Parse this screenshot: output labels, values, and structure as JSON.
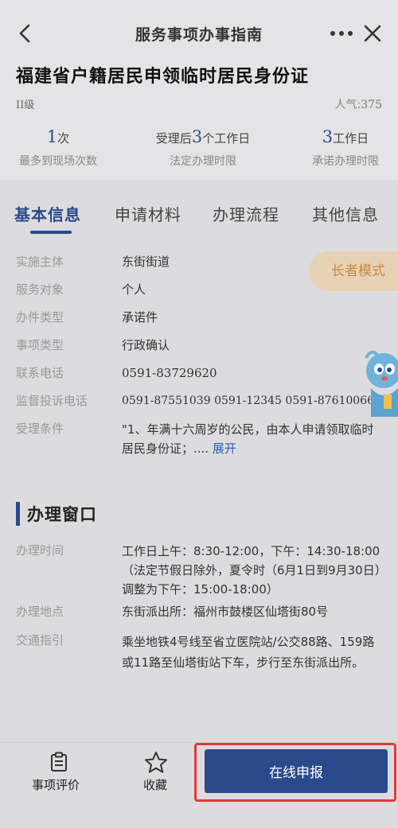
{
  "nav": {
    "title": "服务事项办事指南"
  },
  "item": {
    "title": "福建省户籍居民申领临时居民身份证",
    "level": "II级",
    "popularity_label": "人气:",
    "popularity_value": "375"
  },
  "stats": [
    {
      "pre": "",
      "num": "1",
      "unit": "次",
      "label": "最多到现场次数"
    },
    {
      "pre": "受理后",
      "num": "3",
      "unit": "个工作日",
      "label": "法定办理时限"
    },
    {
      "pre": "",
      "num": "3",
      "unit": "工作日",
      "label": "承诺办理时限"
    }
  ],
  "tabs": [
    "基本信息",
    "申请材料",
    "办理流程",
    "其他信息"
  ],
  "elder_mode": "长者模式",
  "basic_info": [
    {
      "key": "实施主体",
      "value": "东街街道"
    },
    {
      "key": "服务对象",
      "value": "个人"
    },
    {
      "key": "办件类型",
      "value": "承诺件"
    },
    {
      "key": "事项类型",
      "value": "行政确认"
    },
    {
      "key": "联系电话",
      "value": "0591-83729620"
    },
    {
      "key": "监督投诉电话",
      "value": "0591-87551039 0591-12345 0591-87610066"
    },
    {
      "key": "受理条件",
      "value": "\"1、年满十六周岁的公民，由本人申请领取临时居民身份证；....",
      "link": "展开"
    }
  ],
  "window_section": {
    "title": "办理窗口",
    "rows": [
      {
        "key": "办理时间",
        "value": "工作日上午：8:30-12:00，下午：14:30-18:00（法定节假日除外，夏令时（6月1日到9月30日）调整为下午：15:00-18:00）"
      },
      {
        "key": "办理地点",
        "value": "东街派出所：福州市鼓楼区仙塔街80号"
      },
      {
        "key": "交通指引",
        "value": "乘坐地铁4号线至省立医院站/公交88路、159路或11路至仙塔街站下车，步行至东街派出所。"
      }
    ]
  },
  "bottom": {
    "evaluate": "事项评价",
    "favorite": "收藏",
    "apply": "在线申报"
  },
  "colors": {
    "brand": "#2b4a8c",
    "highlight": "#e03a3a",
    "elder_bg": "#e7d2b5"
  }
}
